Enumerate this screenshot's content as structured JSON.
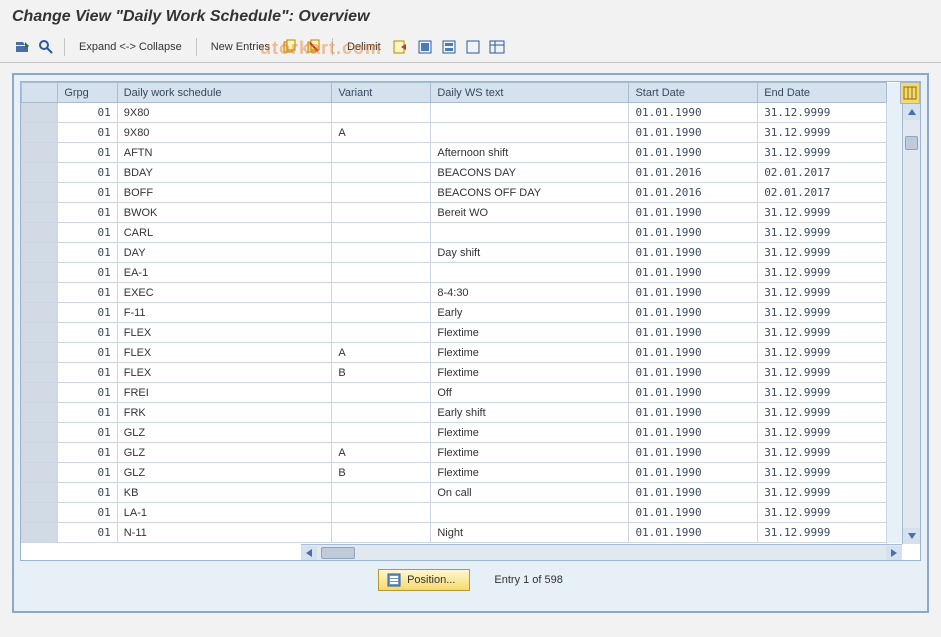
{
  "title": "Change View \"Daily Work Schedule\": Overview",
  "watermark": "utorkart.com",
  "toolbar": {
    "expand": "Expand <-> Collapse",
    "new_entries": "New Entries",
    "delimit": "Delimit"
  },
  "columns": {
    "sel": "",
    "grpg": "Grpg",
    "dws": "Daily work schedule",
    "variant": "Variant",
    "dwstext": "Daily WS text",
    "start": "Start Date",
    "end": "End Date"
  },
  "rows": [
    {
      "grpg": "01",
      "dws": "9X80",
      "variant": "",
      "text": "",
      "start": "01.01.1990",
      "end": "31.12.9999"
    },
    {
      "grpg": "01",
      "dws": "9X80",
      "variant": "A",
      "text": "",
      "start": "01.01.1990",
      "end": "31.12.9999"
    },
    {
      "grpg": "01",
      "dws": "AFTN",
      "variant": "",
      "text": "Afternoon shift",
      "start": "01.01.1990",
      "end": "31.12.9999"
    },
    {
      "grpg": "01",
      "dws": "BDAY",
      "variant": "",
      "text": "BEACONS DAY",
      "start": "01.01.2016",
      "end": "02.01.2017"
    },
    {
      "grpg": "01",
      "dws": "BOFF",
      "variant": "",
      "text": "BEACONS OFF DAY",
      "start": "01.01.2016",
      "end": "02.01.2017"
    },
    {
      "grpg": "01",
      "dws": "BWOK",
      "variant": "",
      "text": "Bereit WO",
      "start": "01.01.1990",
      "end": "31.12.9999"
    },
    {
      "grpg": "01",
      "dws": "CARL",
      "variant": "",
      "text": "",
      "start": "01.01.1990",
      "end": "31.12.9999"
    },
    {
      "grpg": "01",
      "dws": "DAY",
      "variant": "",
      "text": "Day shift",
      "start": "01.01.1990",
      "end": "31.12.9999"
    },
    {
      "grpg": "01",
      "dws": "EA-1",
      "variant": "",
      "text": "",
      "start": "01.01.1990",
      "end": "31.12.9999"
    },
    {
      "grpg": "01",
      "dws": "EXEC",
      "variant": "",
      "text": "8-4:30",
      "start": "01.01.1990",
      "end": "31.12.9999"
    },
    {
      "grpg": "01",
      "dws": "F-11",
      "variant": "",
      "text": "Early",
      "start": "01.01.1990",
      "end": "31.12.9999"
    },
    {
      "grpg": "01",
      "dws": "FLEX",
      "variant": "",
      "text": "Flextime",
      "start": "01.01.1990",
      "end": "31.12.9999"
    },
    {
      "grpg": "01",
      "dws": "FLEX",
      "variant": "A",
      "text": "Flextime",
      "start": "01.01.1990",
      "end": "31.12.9999"
    },
    {
      "grpg": "01",
      "dws": "FLEX",
      "variant": "B",
      "text": "Flextime",
      "start": "01.01.1990",
      "end": "31.12.9999"
    },
    {
      "grpg": "01",
      "dws": "FREI",
      "variant": "",
      "text": "Off",
      "start": "01.01.1990",
      "end": "31.12.9999"
    },
    {
      "grpg": "01",
      "dws": "FRK",
      "variant": "",
      "text": "Early shift",
      "start": "01.01.1990",
      "end": "31.12.9999"
    },
    {
      "grpg": "01",
      "dws": "GLZ",
      "variant": "",
      "text": "Flextime",
      "start": "01.01.1990",
      "end": "31.12.9999"
    },
    {
      "grpg": "01",
      "dws": "GLZ",
      "variant": "A",
      "text": "Flextime",
      "start": "01.01.1990",
      "end": "31.12.9999"
    },
    {
      "grpg": "01",
      "dws": "GLZ",
      "variant": "B",
      "text": "Flextime",
      "start": "01.01.1990",
      "end": "31.12.9999"
    },
    {
      "grpg": "01",
      "dws": "KB",
      "variant": "",
      "text": "On call",
      "start": "01.01.1990",
      "end": "31.12.9999"
    },
    {
      "grpg": "01",
      "dws": "LA-1",
      "variant": "",
      "text": "",
      "start": "01.01.1990",
      "end": "31.12.9999"
    },
    {
      "grpg": "01",
      "dws": "N-11",
      "variant": "",
      "text": "Night",
      "start": "01.01.1990",
      "end": "31.12.9999"
    }
  ],
  "footer": {
    "position_label": "Position...",
    "entry_text": "Entry 1 of 598"
  }
}
